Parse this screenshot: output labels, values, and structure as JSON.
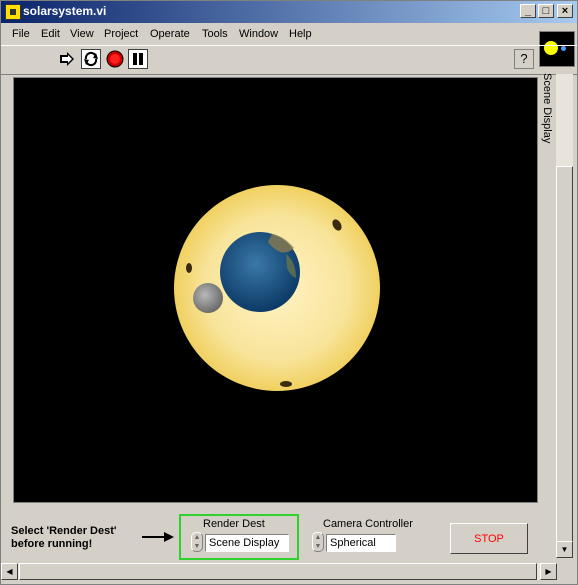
{
  "window": {
    "title": "solarsystem.vi"
  },
  "menubar": {
    "items": [
      "File",
      "Edit",
      "View",
      "Project",
      "Operate",
      "Tools",
      "Window",
      "Help"
    ]
  },
  "toolbar": {
    "help_label": "?"
  },
  "scene": {
    "side_label": "Scene Display"
  },
  "controls": {
    "note": [
      "Select 'Render Dest'",
      "before running!"
    ],
    "render_dest": {
      "label": "Render Dest",
      "value": "Scene Display"
    },
    "camera_controller": {
      "label": "Camera Controller",
      "value": "Spherical"
    },
    "stop": {
      "label": "STOP"
    }
  },
  "colors": {
    "render_dest_highlight": "#2fd12f",
    "stop_text": "#ff0000",
    "title_bar": "#0a246a"
  }
}
